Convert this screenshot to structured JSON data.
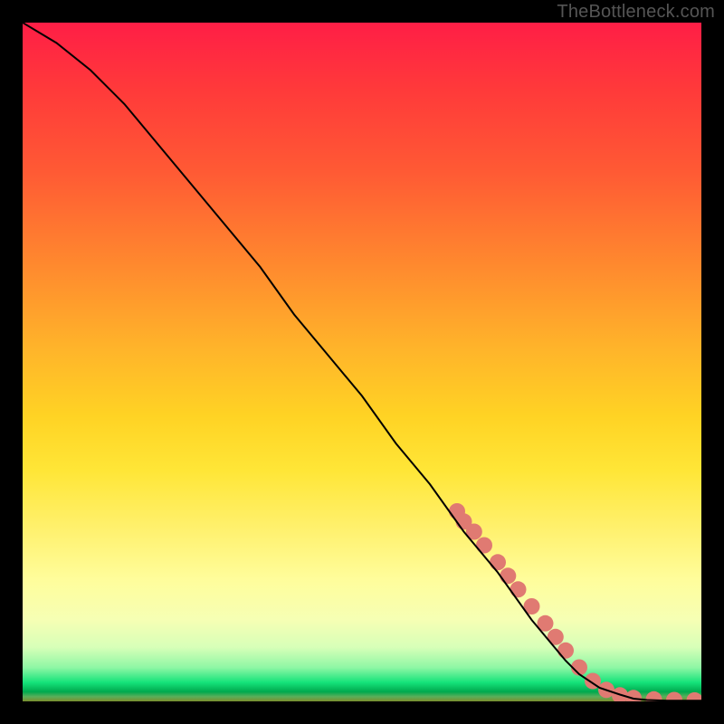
{
  "attribution": "TheBottleneck.com",
  "chart_data": {
    "type": "line",
    "title": "",
    "xlabel": "",
    "ylabel": "",
    "xlim": [
      0,
      100
    ],
    "ylim": [
      0,
      100
    ],
    "grid": false,
    "legend": false,
    "series": [
      {
        "name": "curve",
        "color": "#000000",
        "x": [
          0,
          5,
          10,
          15,
          20,
          25,
          30,
          35,
          40,
          45,
          50,
          55,
          60,
          65,
          70,
          75,
          80,
          82,
          85,
          88,
          90,
          92,
          95,
          100
        ],
        "y": [
          100,
          97,
          93,
          88,
          82,
          76,
          70,
          64,
          57,
          51,
          45,
          38,
          32,
          25,
          19,
          12,
          6,
          4,
          2,
          1,
          0.4,
          0.2,
          0.1,
          0.1
        ]
      }
    ],
    "markers": {
      "name": "highlight-dots",
      "color": "#e07a72",
      "points": [
        {
          "x": 64,
          "y": 28
        },
        {
          "x": 65,
          "y": 26.5
        },
        {
          "x": 66.5,
          "y": 25
        },
        {
          "x": 68,
          "y": 23
        },
        {
          "x": 70,
          "y": 20.5
        },
        {
          "x": 71.5,
          "y": 18.5
        },
        {
          "x": 73,
          "y": 16.5
        },
        {
          "x": 75,
          "y": 14
        },
        {
          "x": 77,
          "y": 11.5
        },
        {
          "x": 78.5,
          "y": 9.5
        },
        {
          "x": 80,
          "y": 7.5
        },
        {
          "x": 82,
          "y": 5
        },
        {
          "x": 84,
          "y": 3
        },
        {
          "x": 86,
          "y": 1.7
        },
        {
          "x": 88,
          "y": 0.9
        },
        {
          "x": 90,
          "y": 0.5
        },
        {
          "x": 93,
          "y": 0.3
        },
        {
          "x": 96,
          "y": 0.2
        },
        {
          "x": 99,
          "y": 0.15
        }
      ]
    }
  }
}
